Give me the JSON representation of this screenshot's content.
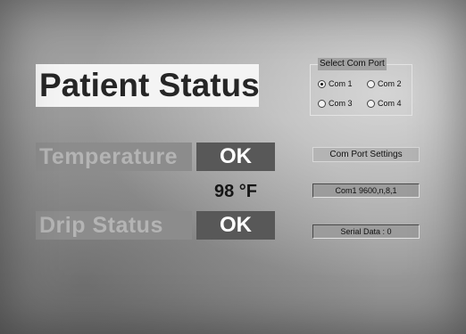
{
  "title": "Patient Status",
  "rows": [
    {
      "label": "Temperature",
      "value": "OK"
    },
    {
      "label": "Drip Status",
      "value": "OK"
    }
  ],
  "temperature_reading": "98 °F",
  "com_port": {
    "group_title": "Select Com Port",
    "options": [
      {
        "label": "Com 1",
        "selected": true
      },
      {
        "label": "Com 2",
        "selected": false
      },
      {
        "label": "Com 3",
        "selected": false
      },
      {
        "label": "Com 4",
        "selected": false
      }
    ]
  },
  "settings_button_label": "Com Port Settings",
  "port_settings_value": "Com1 9600,n,8,1",
  "serial_data_text": "Serial Data : 0"
}
